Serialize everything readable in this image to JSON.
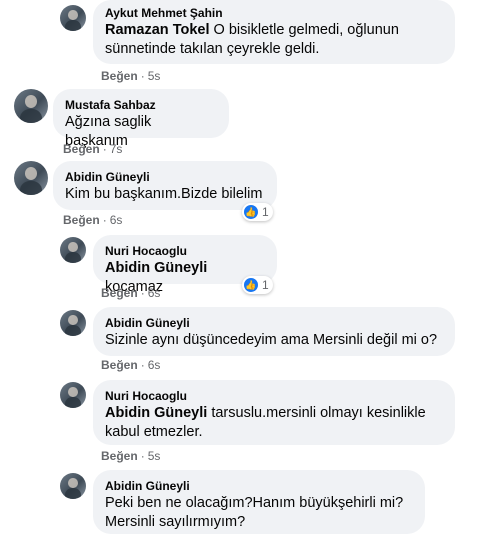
{
  "comments": [
    {
      "name": "Aykut Mehmet Şahin",
      "mention": "Ramazan Tokel",
      "text": " O bisikletle gelmedi, oğlunun sünnetinde takılan çeyrekle geldi.",
      "like": "Beğen",
      "time": "5s"
    },
    {
      "name": "Mustafa Sahbaz",
      "text": "Ağzına saglik başkanım",
      "like": "Beğen",
      "time": "7s"
    },
    {
      "name": "Abidin Güneyli",
      "text": "Kim bu başkanım.Bizde bilelim",
      "like": "Beğen",
      "time": "6s",
      "reaction_count": "1"
    },
    {
      "name": "Nuri Hocaoglu",
      "mention": "Abidin Güneyli",
      "text": " kocamaz",
      "like": "Beğen",
      "time": "6s",
      "reaction_count": "1"
    },
    {
      "name": "Abidin Güneyli",
      "text": "Sizinle aynı düşüncedeyim ama Mersinli değil mi o?",
      "like": "Beğen",
      "time": "6s"
    },
    {
      "name": "Nuri Hocaoglu",
      "mention": "Abidin Güneyli",
      "text": " tarsuslu.mersinli olmayı kesinlikle kabul etmezler.",
      "like": "Beğen",
      "time": "5s"
    },
    {
      "name": "Abidin Güneyli",
      "text": "Peki ben ne olacağım?Hanım büyükşehirli mi? Mersinli sayılırmıyım?"
    }
  ],
  "separator": "·",
  "colors": {
    "bubble": "#f0f2f5",
    "meta": "#65676b",
    "like_blue": "#1877f2"
  }
}
